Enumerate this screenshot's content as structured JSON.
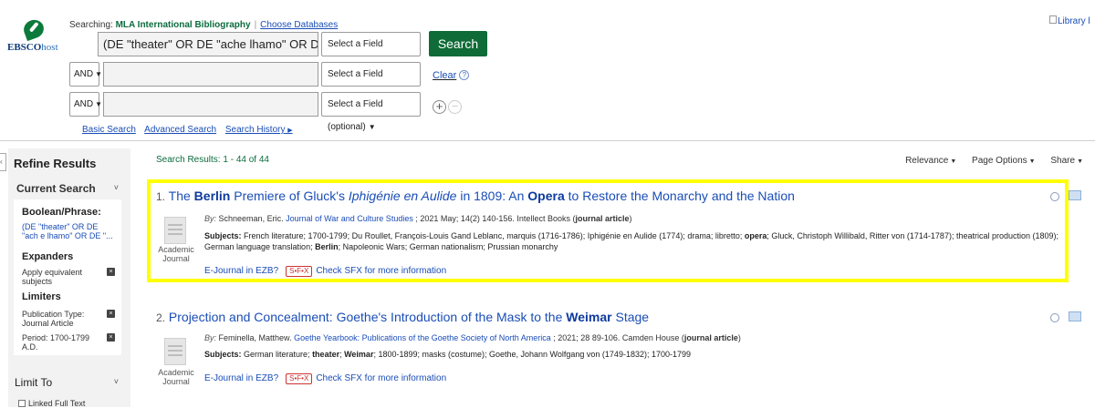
{
  "header": {
    "logo_brand": "EBSCO",
    "logo_suffix": "host",
    "searching_label": "Searching:",
    "database": "MLA International Bibliography",
    "choose_databases": "Choose Databases",
    "library_link": "Library l",
    "rows": [
      {
        "operator": "",
        "query": "(DE \"theater\" OR DE \"ache lhamo\" OR DE \"alterna",
        "field": "Select a Field (optional)"
      },
      {
        "operator": "AND",
        "query": "",
        "field": "Select a Field (optional)"
      },
      {
        "operator": "AND",
        "query": "",
        "field": "Select a Field (optional)"
      }
    ],
    "search_button": "Search",
    "clear": "Clear",
    "help_icon": "?",
    "links": [
      "Basic Search",
      "Advanced Search",
      "Search History"
    ]
  },
  "sidebar": {
    "collapse_glyph": "‹",
    "title": "Refine Results",
    "current_search": "Current Search",
    "boolean_heading": "Boolean/Phrase:",
    "boolean_value": "(DE \"theater\" OR DE \"ach e lhamo\" OR DE \"...",
    "expanders_heading": "Expanders",
    "expander_item": "Apply equivalent subjects",
    "limiters_heading": "Limiters",
    "limiter_pub": "Publication Type: Journal Article",
    "limiter_period": "Period: 1700-1799 A.D.",
    "limit_to": "Limit To",
    "linked_full_text": "Linked Full Text"
  },
  "results_header": {
    "label": "Search Results:",
    "range": "1 - 44 of 44",
    "relevance": "Relevance",
    "page_options": "Page Options",
    "share": "Share"
  },
  "results": [
    {
      "num": "1.",
      "title_parts": [
        {
          "t": "The ",
          "s": ""
        },
        {
          "t": "Berlin",
          "s": "b"
        },
        {
          "t": " Premiere of Gluck's ",
          "s": ""
        },
        {
          "t": "Iphigénie en Aulide",
          "s": "i"
        },
        {
          "t": " in 1809: An ",
          "s": ""
        },
        {
          "t": "Opera",
          "s": "b"
        },
        {
          "t": " to Restore the Monarchy and the Nation",
          "s": ""
        }
      ],
      "by_label": "By:",
      "author": "Schneeman, Eric.",
      "journal": "Journal of War and Culture Studies",
      "citation": "; 2021 May; 14(2) 140-156. Intellect Books (",
      "doctype": "journal article",
      "citation_end": ")",
      "subjects_label": "Subjects:",
      "subjects": [
        {
          "t": "French literature; 1700-1799; Du Roullet, François-Louis Gand Leblanc, marquis (1716-1786); Iphigénie en Aulide (1774); drama; libretto; ",
          "s": ""
        },
        {
          "t": "opera",
          "s": "b"
        },
        {
          "t": "; Gluck, Christoph Willibald, Ritter von (1714-1787); theatrical production (1809); German language translation; ",
          "s": ""
        },
        {
          "t": "Berlin",
          "s": "b"
        },
        {
          "t": "; Napoleonic Wars; German nationalism; Prussian monarchy",
          "s": ""
        }
      ],
      "type_caption": "Academic Journal",
      "ejournal": "E-Journal in EZB?",
      "sfx": "S•F•X",
      "sfx_link": "Check SFX for more information"
    },
    {
      "num": "2.",
      "title_parts": [
        {
          "t": "Projection and Concealment: Goethe's Introduction of the Mask to the ",
          "s": ""
        },
        {
          "t": "Weimar",
          "s": "b"
        },
        {
          "t": " Stage",
          "s": ""
        }
      ],
      "by_label": "By:",
      "author": "Feminella, Matthew.",
      "journal": "Goethe Yearbook: Publications of the Goethe Society of North America",
      "citation": "; 2021; 28 89-106. Camden House (",
      "doctype": "journal article",
      "citation_end": ")",
      "subjects_label": "Subjects:",
      "subjects": [
        {
          "t": "German literature; ",
          "s": ""
        },
        {
          "t": "theater",
          "s": "b"
        },
        {
          "t": "; ",
          "s": ""
        },
        {
          "t": "Weimar",
          "s": "b"
        },
        {
          "t": "; 1800-1899; masks (costume); Goethe, Johann Wolfgang von (1749-1832); 1700-1799",
          "s": ""
        }
      ],
      "type_caption": "Academic Journal",
      "ejournal": "E-Journal in EZB?",
      "sfx": "S•F•X",
      "sfx_link": "Check SFX for more information"
    }
  ]
}
